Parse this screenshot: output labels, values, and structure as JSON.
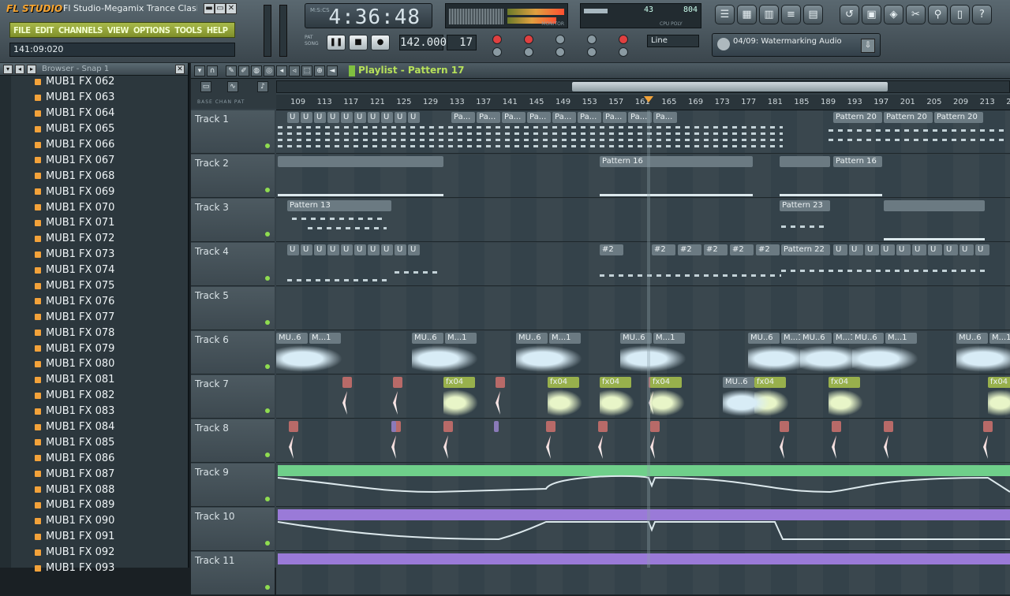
{
  "window": {
    "logo": "FL STUDIO",
    "title": "Fl Studio-Megamix Trance Clasi...",
    "btn_min": "▬",
    "btn_max": "▭",
    "btn_close": "✕"
  },
  "menu": [
    "FILE",
    "EDIT",
    "CHANNELS",
    "VIEW",
    "OPTIONS",
    "TOOLS",
    "HELP"
  ],
  "hint_bar": "141:09:020",
  "time_display": "4:36:48",
  "time_mode": "M:S:CS",
  "monitor_label": "MONITOR",
  "cpu": {
    "value1": "43",
    "value2": "804",
    "label": "CPU  POLY"
  },
  "tempo": "142.000",
  "pattern_number": "17",
  "pat_song": [
    "PAT",
    "SONG"
  ],
  "snap": "Line",
  "hint_panel": "04/09: Watermarking Audio",
  "toolbar_icons": [
    "playlist-icon",
    "step-sequencer-icon",
    "piano-roll-icon",
    "browser-icon",
    "mixer-icon",
    "undo-icon",
    "save-icon",
    "render-icon",
    "plugin-icon",
    "tools-icon",
    "doc-icon",
    "help-icon"
  ],
  "browser": {
    "title": "Browser - Snap 1",
    "items": [
      "MUB1 FX 062",
      "MUB1 FX 063",
      "MUB1 FX 064",
      "MUB1 FX 065",
      "MUB1 FX 066",
      "MUB1 FX 067",
      "MUB1 FX 068",
      "MUB1 FX 069",
      "MUB1 FX 070",
      "MUB1 FX 071",
      "MUB1 FX 072",
      "MUB1 FX 073",
      "MUB1 FX 074",
      "MUB1 FX 075",
      "MUB1 FX 076",
      "MUB1 FX 077",
      "MUB1 FX 078",
      "MUB1 FX 079",
      "MUB1 FX 080",
      "MUB1 FX 081",
      "MUB1 FX 082",
      "MUB1 FX 083",
      "MUB1 FX 084",
      "MUB1 FX 085",
      "MUB1 FX 086",
      "MUB1 FX 087",
      "MUB1 FX 088",
      "MUB1 FX 089",
      "MUB1 FX 090",
      "MUB1 FX 091",
      "MUB1 FX 092",
      "MUB1 FX 093"
    ]
  },
  "playlist": {
    "title": "Playlist - Pattern 17",
    "modes": "BASE  CHAN  PAT",
    "ruler": [
      "109",
      "113",
      "117",
      "121",
      "125",
      "129",
      "133",
      "137",
      "141",
      "145",
      "149",
      "153",
      "157",
      "161",
      "165",
      "169",
      "173",
      "177",
      "181",
      "185",
      "189",
      "193",
      "197",
      "201",
      "205",
      "209",
      "213",
      "217"
    ],
    "tracks": [
      "Track 1",
      "Track 2",
      "Track 3",
      "Track 4",
      "Track 5",
      "Track 6",
      "Track 7",
      "Track 8",
      "Track 9",
      "Track 10",
      "Track 11"
    ],
    "clip_labels": {
      "pattern20": "Pattern 20",
      "pattern16": "Pattern 16",
      "pattern13": "Pattern 13",
      "pattern23": "Pattern 23",
      "pattern22": "Pattern 22",
      "pa": "Pa...",
      "p2": "#2",
      "mu6": "MU..6",
      "m1": "M...1",
      "fx04": "fx04",
      "u": "U"
    }
  },
  "colors": {
    "accent_green": "#b6e05a",
    "track9": "#6fcf8a",
    "track10": "#9a7ad8",
    "playhead": "#f2a33a"
  }
}
